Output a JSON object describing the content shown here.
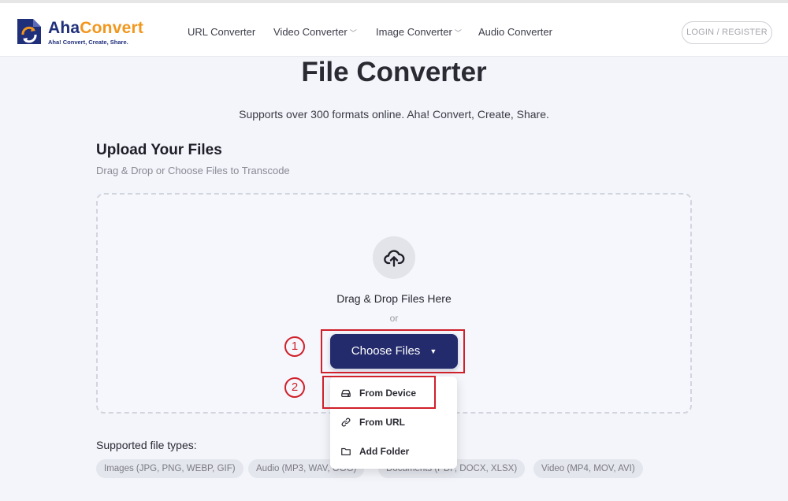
{
  "brand": {
    "name_part1": "Aha",
    "name_part2": "Convert",
    "tagline": "Aha! Convert, Create, Share."
  },
  "nav": [
    {
      "label": "URL Converter",
      "dropdown": false
    },
    {
      "label": "Video Converter",
      "dropdown": true
    },
    {
      "label": "Image Converter",
      "dropdown": true
    },
    {
      "label": "Audio Converter",
      "dropdown": false
    }
  ],
  "login_label": "LOGIN / REGISTER",
  "page_title": "File Converter",
  "subtitle": "Supports over 300 formats online. Aha! Convert, Create, Share.",
  "upload": {
    "title": "Upload Your Files",
    "subtitle": "Drag & Drop or Choose Files to Transcode",
    "drop_text": "Drag & Drop Files Here",
    "or_text": "or",
    "choose_label": "Choose Files",
    "choose_arrow": "▼"
  },
  "menu": [
    {
      "label": "From Device",
      "icon": "drive-icon"
    },
    {
      "label": "From URL",
      "icon": "link-icon"
    },
    {
      "label": "Add Folder",
      "icon": "folder-icon"
    }
  ],
  "annotations": {
    "step1": "1",
    "step2": "2",
    "color": "#d0202a"
  },
  "supported": {
    "label": "Supported file types:",
    "chips": [
      "Images (JPG, PNG, WEBP, GIF)",
      "Audio (MP3, WAV, OGG)",
      "Documents (PDF, DOCX, XLSX)",
      "Video (MP4, MOV, AVI)"
    ]
  },
  "colors": {
    "accent": "#232b6c",
    "brand_orange": "#f2961c",
    "brand_blue": "#1f2f7a"
  }
}
